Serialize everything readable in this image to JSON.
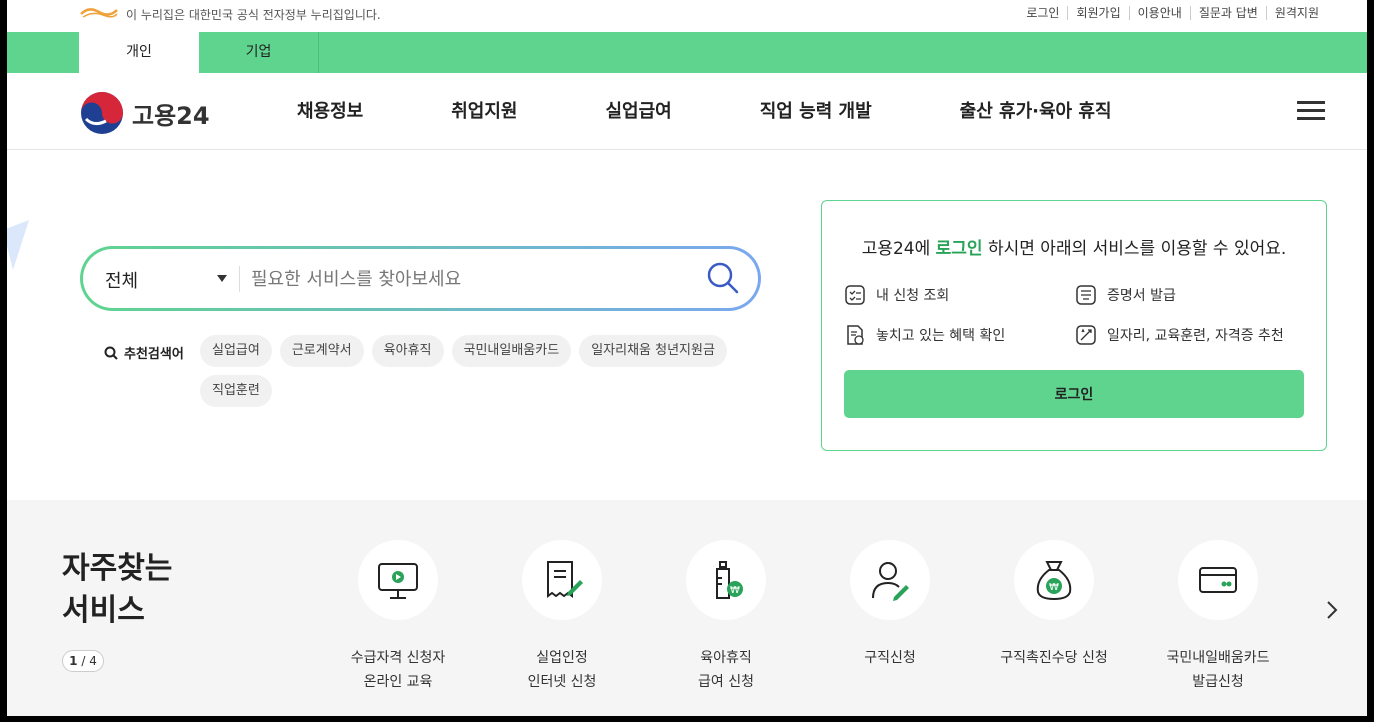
{
  "gov": {
    "notice": "이 누리집은 대한민국 공식 전자정부 누리집입니다.",
    "links": [
      "로그인",
      "회원가입",
      "이용안내",
      "질문과 답변",
      "원격지원"
    ]
  },
  "tabs": [
    {
      "label": "개인",
      "active": true
    },
    {
      "label": "기업",
      "active": false
    }
  ],
  "header": {
    "logo_text": "고용24",
    "nav": [
      "채용정보",
      "취업지원",
      "실업급여",
      "직업 능력 개발",
      "출산 휴가·육아 휴직"
    ]
  },
  "search": {
    "scope": "전체",
    "placeholder": "필요한 서비스를 찾아보세요",
    "recommend_label": "추천검색어",
    "keywords": [
      "실업급여",
      "근로계약서",
      "육아휴직",
      "국민내일배움카드",
      "일자리채움 청년지원금",
      "직업훈련"
    ]
  },
  "login_box": {
    "title_pre": "고용24에 ",
    "title_hl": "로그인",
    "title_post": " 하시면 아래의 서비스를 이용할 수 있어요.",
    "services": [
      {
        "label": "내 신청 조회",
        "icon": "checklist-icon"
      },
      {
        "label": "증명서 발급",
        "icon": "certificate-icon"
      },
      {
        "label": "놓치고 있는 혜택 확인",
        "icon": "benefit-icon"
      },
      {
        "label": "일자리, 교육훈련, 자격증 추천",
        "icon": "recommend-icon"
      }
    ],
    "button": "로그인"
  },
  "frequent": {
    "title_line1": "자주찾는",
    "title_line2": "서비스",
    "page_current": "1",
    "page_total": "4",
    "items": [
      {
        "line1": "수급자격 신청자",
        "line2": "온라인 교육",
        "icon": "monitor-play-icon"
      },
      {
        "line1": "실업인정",
        "line2": "인터넷 신청",
        "icon": "document-pen-icon"
      },
      {
        "line1": "육아휴직",
        "line2": "급여 신청",
        "icon": "baby-bottle-icon"
      },
      {
        "line1": "구직신청",
        "line2": "",
        "icon": "person-pen-icon"
      },
      {
        "line1": "구직촉진수당 신청",
        "line2": "",
        "icon": "money-bag-icon"
      },
      {
        "line1": "국민내일배움카드",
        "line2": "발급신청",
        "icon": "card-icon"
      }
    ]
  },
  "colors": {
    "brand_green": "#5fd48f",
    "highlight_green": "#2aa35a"
  }
}
